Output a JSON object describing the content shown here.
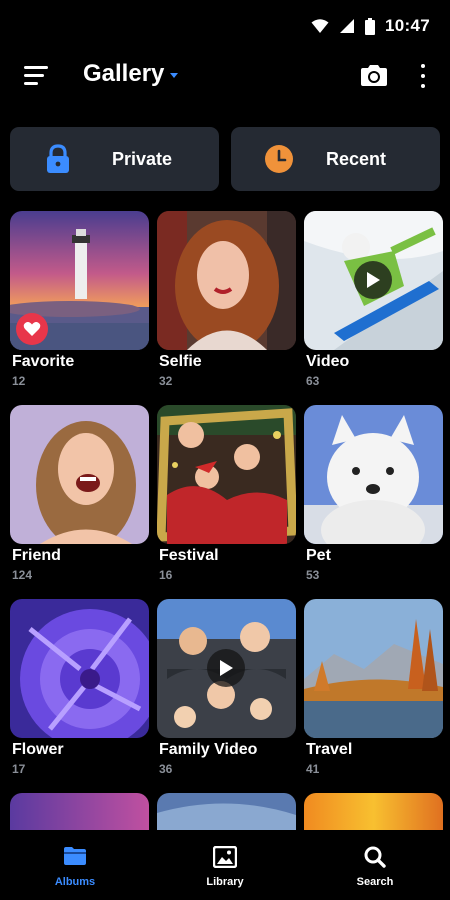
{
  "status": {
    "time": "10:47"
  },
  "appbar": {
    "title": "Gallery"
  },
  "quick_actions": [
    {
      "label": "Private",
      "icon": "lock-icon",
      "color": "#3b8cff"
    },
    {
      "label": "Recent",
      "icon": "clock-icon",
      "color": "#f0923a"
    }
  ],
  "albums": [
    {
      "name": "Favorite",
      "count": "12",
      "badge": "heart"
    },
    {
      "name": "Selfie",
      "count": "32"
    },
    {
      "name": "Video",
      "count": "63",
      "badge": "play"
    },
    {
      "name": "Friend",
      "count": "124"
    },
    {
      "name": "Festival",
      "count": "16"
    },
    {
      "name": "Pet",
      "count": "53"
    },
    {
      "name": "Flower",
      "count": "17"
    },
    {
      "name": "Family Video",
      "count": "36",
      "badge": "play"
    },
    {
      "name": "Travel",
      "count": "41"
    }
  ],
  "bottom_nav": [
    {
      "label": "Albums",
      "icon": "folder-icon",
      "active": true
    },
    {
      "label": "Library",
      "icon": "image-icon",
      "active": false
    },
    {
      "label": "Search",
      "icon": "search-icon",
      "active": false
    }
  ],
  "colors": {
    "accent": "#3b8cff",
    "card_bg": "#252a33",
    "count_text": "#8a8f98",
    "heart": "#e8364a"
  }
}
